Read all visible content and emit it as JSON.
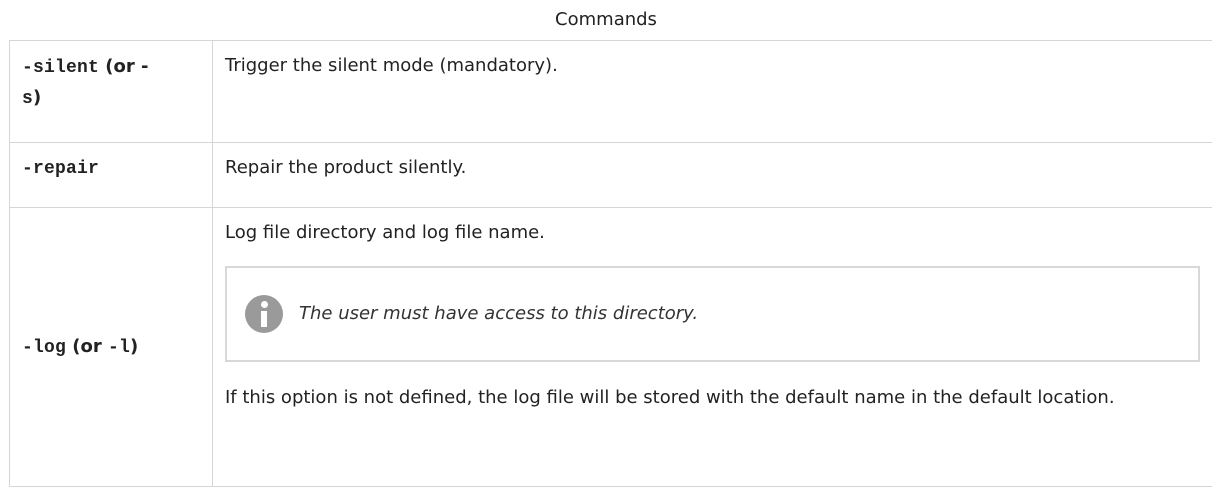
{
  "caption": "Commands",
  "rows": [
    {
      "option_code": "-silent",
      "option_rest": " (or -",
      "option_code2": "s",
      "option_close": ")",
      "description": "Trigger the silent mode (mandatory)."
    },
    {
      "option_code": "-repair",
      "description": "Repair the product silently."
    },
    {
      "option_code": "-log",
      "option_rest": " (or ",
      "option_code2": "-l",
      "option_close": ")",
      "description": "Log file directory and log file name.",
      "note": {
        "icon": "info-icon",
        "text": "The user must have access to this directory."
      },
      "after_note": "If this option is not defined, the log file will be stored with the default name in the default location."
    }
  ]
}
